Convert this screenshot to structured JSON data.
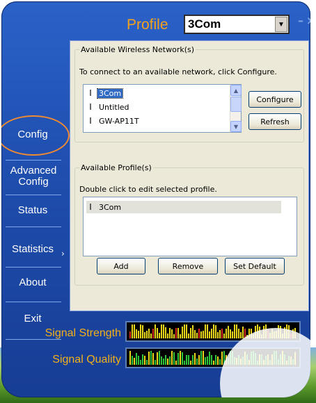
{
  "window": {
    "title": "Profile",
    "profile_selected": "3Com",
    "minimize_glyph": "–",
    "close_glyph": "×"
  },
  "nav": {
    "items": [
      {
        "label": "Config"
      },
      {
        "label": "Advanced Config"
      },
      {
        "label": "Status"
      },
      {
        "label": "Statistics"
      },
      {
        "label": "About"
      },
      {
        "label": "Exit"
      }
    ],
    "active": "Config"
  },
  "networks": {
    "legend": "Available Wireless Network(s)",
    "hint": "To connect to an available network, click Configure.",
    "items": [
      {
        "name": "3Com",
        "selected": true
      },
      {
        "name": "Untitled",
        "selected": false
      },
      {
        "name": "GW-AP11T",
        "selected": false
      }
    ],
    "configure_label": "Configure",
    "refresh_label": "Refresh"
  },
  "profiles": {
    "legend": "Available Profile(s)",
    "hint": "Double click to edit selected profile.",
    "items": [
      {
        "name": "3Com"
      }
    ],
    "add_label": "Add",
    "remove_label": "Remove",
    "set_default_label": "Set Default"
  },
  "signal": {
    "strength_label": "Signal Strength",
    "quality_label": "Signal Quality"
  },
  "colors": {
    "accent_orange": "#f6a21a",
    "meter_yellow": "#e8d619",
    "meter_green": "#2ec53a",
    "meter_red": "#d8281c"
  },
  "icons": {
    "network_item": "antenna-icon",
    "profile_item": "antenna-icon",
    "dropdown": "chevron-down-icon",
    "scroll_up": "chevron-up-icon",
    "scroll_down": "chevron-down-icon",
    "nav_expand": "chevron-right-icon"
  }
}
